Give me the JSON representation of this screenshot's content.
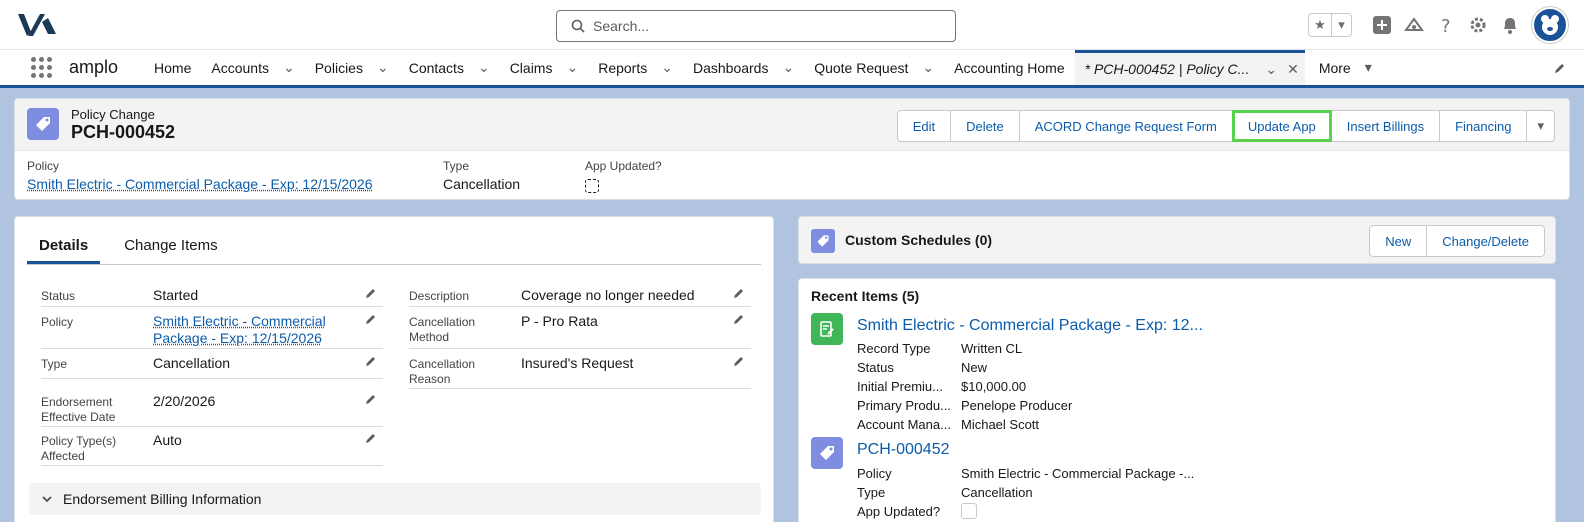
{
  "search": {
    "placeholder": "Search..."
  },
  "nav": {
    "app_name": "amplo",
    "items": [
      {
        "label": "Home",
        "dropdown": false
      },
      {
        "label": "Accounts",
        "dropdown": true
      },
      {
        "label": "Policies",
        "dropdown": true
      },
      {
        "label": "Contacts",
        "dropdown": true
      },
      {
        "label": "Claims",
        "dropdown": true
      },
      {
        "label": "Reports",
        "dropdown": true
      },
      {
        "label": "Dashboards",
        "dropdown": true
      },
      {
        "label": "Quote Request",
        "dropdown": true
      },
      {
        "label": "Accounting Home",
        "dropdown": false
      }
    ],
    "active_tab": "* PCH-000452 | Policy C...",
    "more": "More"
  },
  "record": {
    "object_type": "Policy Change",
    "name": "PCH-000452",
    "actions": [
      "Edit",
      "Delete",
      "ACORD Change Request Form",
      "Update App",
      "Insert Billings",
      "Financing"
    ],
    "highlighted_action": "Update App",
    "highlights": {
      "policy_label": "Policy",
      "policy_value": "Smith Electric - Commercial Package - Exp: 12/15/2026",
      "type_label": "Type",
      "type_value": "Cancellation",
      "app_updated_label": "App Updated?"
    }
  },
  "details": {
    "tabs": [
      "Details",
      "Change Items"
    ],
    "left_fields": [
      {
        "label": "Status",
        "value": "Started"
      },
      {
        "label": "Policy",
        "value": "Smith Electric - Commercial Package - Exp: 12/15/2026"
      },
      {
        "label": "Type",
        "value": "Cancellation"
      },
      {
        "label": "Endorsement Effective Date",
        "value": "2/20/2026"
      },
      {
        "label": "Policy Type(s) Affected",
        "value": "Auto"
      }
    ],
    "right_fields": [
      {
        "label": "Description",
        "value": "Coverage no longer needed"
      },
      {
        "label": "Cancellation Method",
        "value": "P - Pro Rata"
      },
      {
        "label": "Cancellation Reason",
        "value": "Insured's Request"
      }
    ],
    "section": "Endorsement Billing Information"
  },
  "custom_schedules": {
    "title": "Custom Schedules (0)",
    "new_label": "New",
    "change_delete_label": "Change/Delete"
  },
  "recent_items": {
    "title": "Recent Items (5)",
    "items": [
      {
        "name": "Smith Electric - Commercial Package - Exp: 12...",
        "icon": "policy-icon",
        "icon_color": "#41b658",
        "rows": [
          {
            "k": "Record Type",
            "v": "Written CL"
          },
          {
            "k": "Status",
            "v": "New"
          },
          {
            "k": "Initial Premiu...",
            "v": "$10,000.00"
          },
          {
            "k": "Primary Produ...",
            "v": "Penelope Producer"
          },
          {
            "k": "Account Mana...",
            "v": "Michael Scott"
          }
        ]
      },
      {
        "name": "PCH-000452",
        "icon": "policy-change-icon",
        "icon_color": "#7f8de1",
        "rows": [
          {
            "k": "Policy",
            "v": "Smith Electric - Commercial Package -..."
          },
          {
            "k": "Type",
            "v": "Cancellation"
          },
          {
            "k": "App Updated?",
            "v": ""
          }
        ]
      }
    ]
  },
  "colors": {
    "brand": "#1b5297",
    "link": "#0b5cab",
    "highlight": "#58d24a"
  }
}
